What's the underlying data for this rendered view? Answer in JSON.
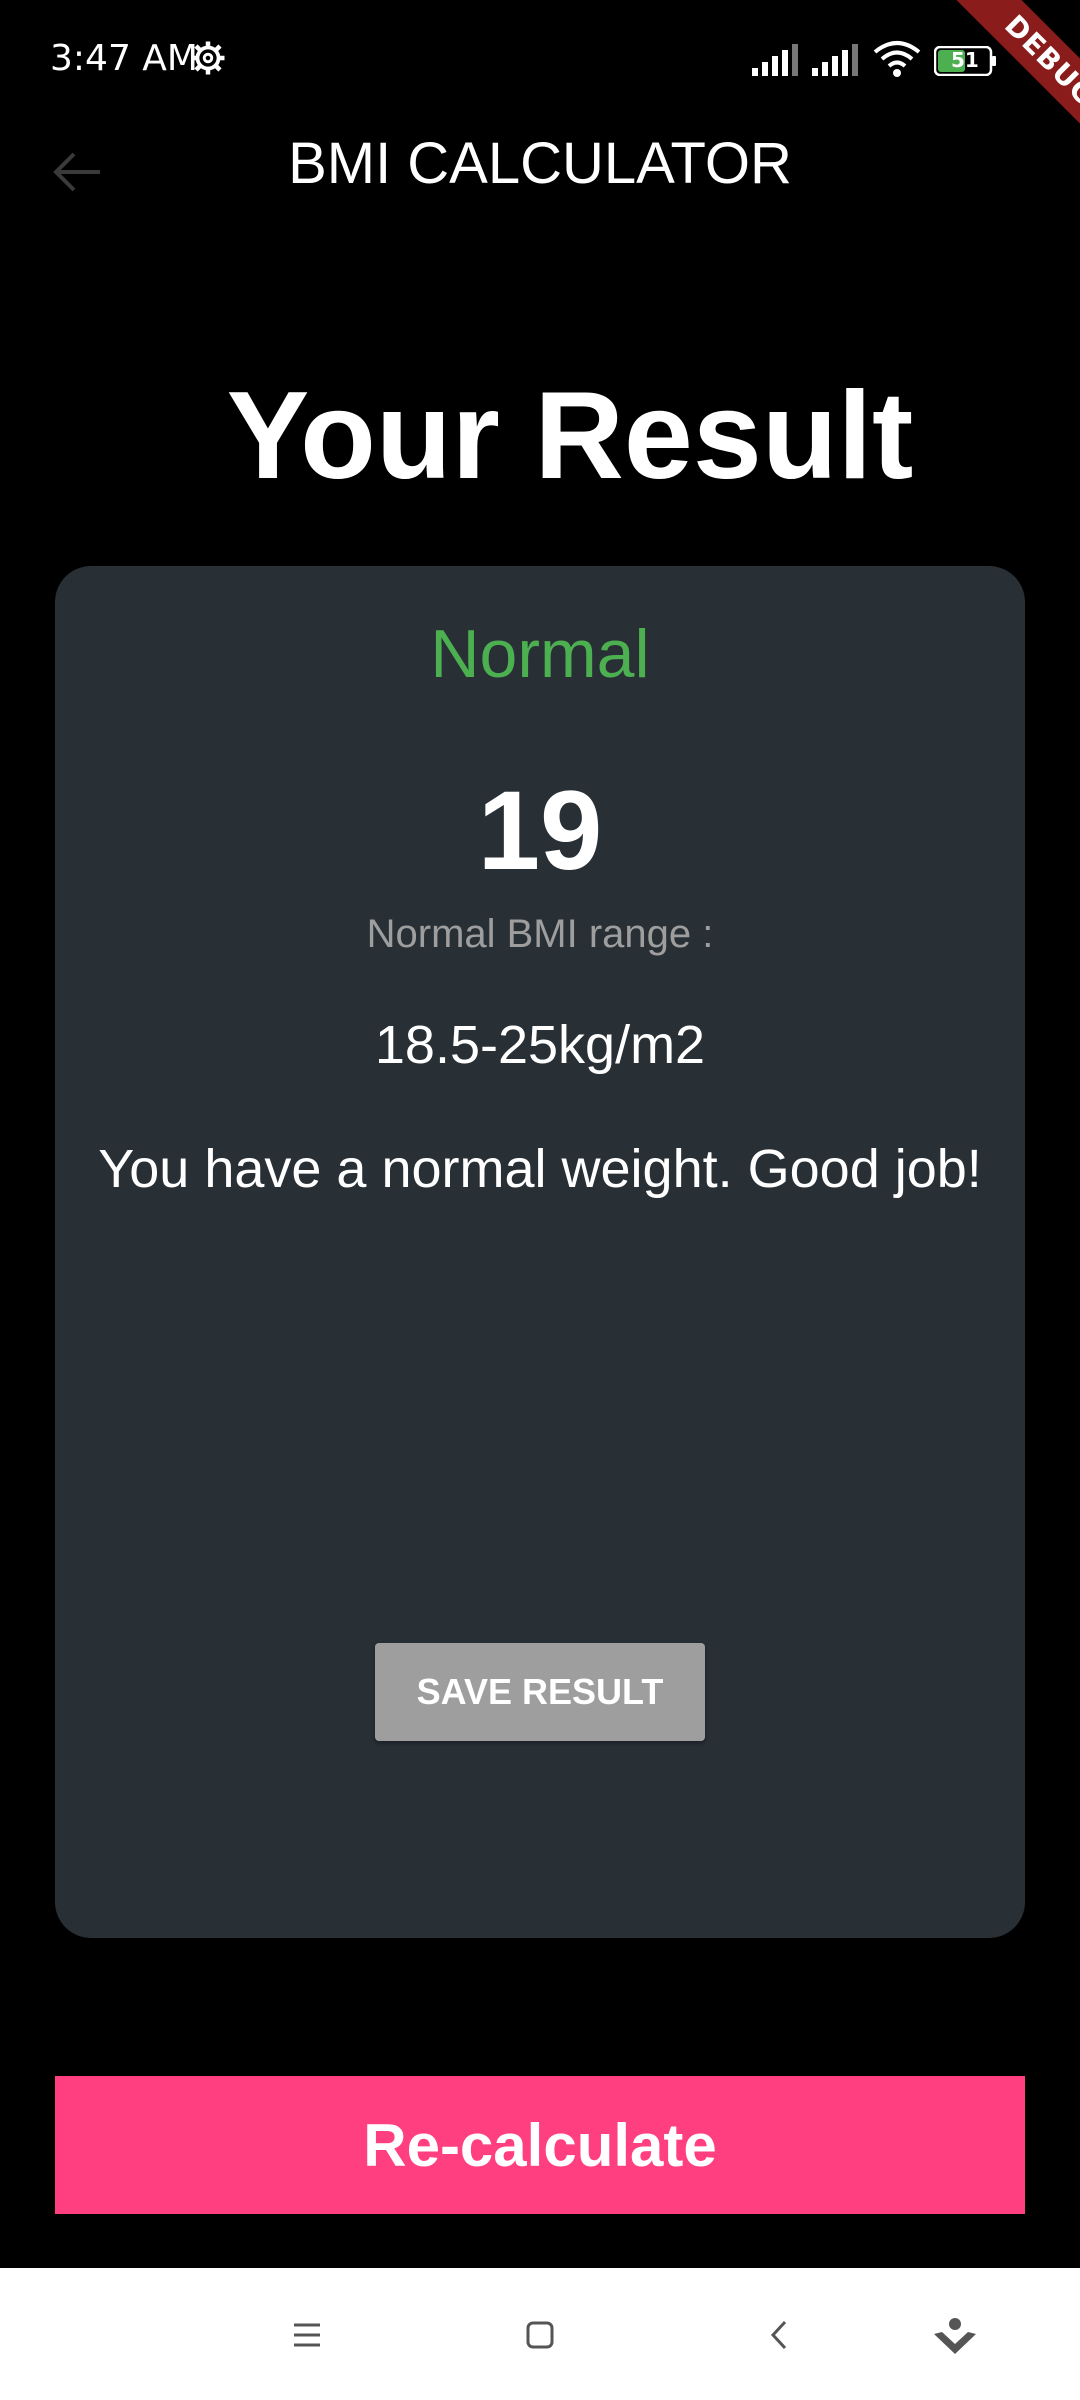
{
  "status_bar": {
    "time": "3:47 AM",
    "battery_level": "51",
    "debug_label": "DEBUG"
  },
  "app_bar": {
    "title": "BMI CALCULATOR"
  },
  "result": {
    "heading": "Your Result",
    "status": "Normal",
    "bmi": "19",
    "range_label": "Normal BMI range :",
    "range_value": "18.5-25kg/m2",
    "message": "You have a normal weight. Good job!",
    "save_label": "SAVE RESULT"
  },
  "actions": {
    "recalculate_label": "Re-calculate"
  },
  "colors": {
    "background": "#000000",
    "card": "#283036",
    "status_normal": "#4caf50",
    "accent": "#ff3f80",
    "save_button": "#9e9e9e"
  },
  "nav_bar": {
    "icons": [
      "menu-icon",
      "home-icon",
      "back-icon",
      "assistant-icon"
    ]
  }
}
